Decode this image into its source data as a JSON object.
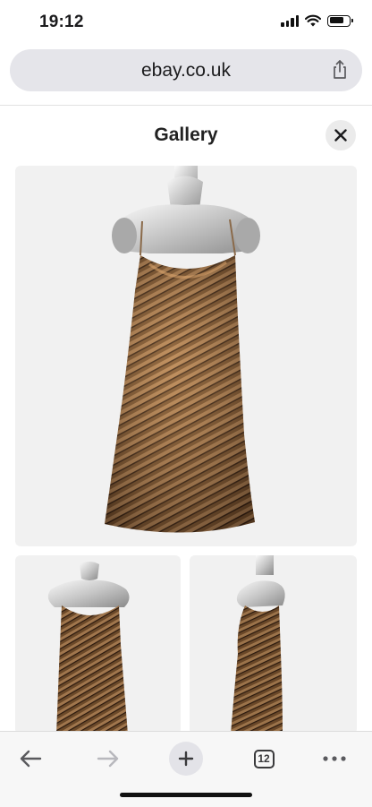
{
  "status_bar": {
    "time": "19:12"
  },
  "address_bar": {
    "url": "ebay.co.uk"
  },
  "gallery": {
    "title": "Gallery",
    "images": [
      {
        "name": "gold sequin dress front view"
      },
      {
        "name": "gold sequin dress angled view"
      },
      {
        "name": "gold sequin dress side view"
      }
    ]
  },
  "toolbar": {
    "tab_count": "12"
  },
  "colors": {
    "sequin_gold": "#8a6238",
    "sequin_dark": "#3d2616",
    "background": "#f1f1f1"
  }
}
